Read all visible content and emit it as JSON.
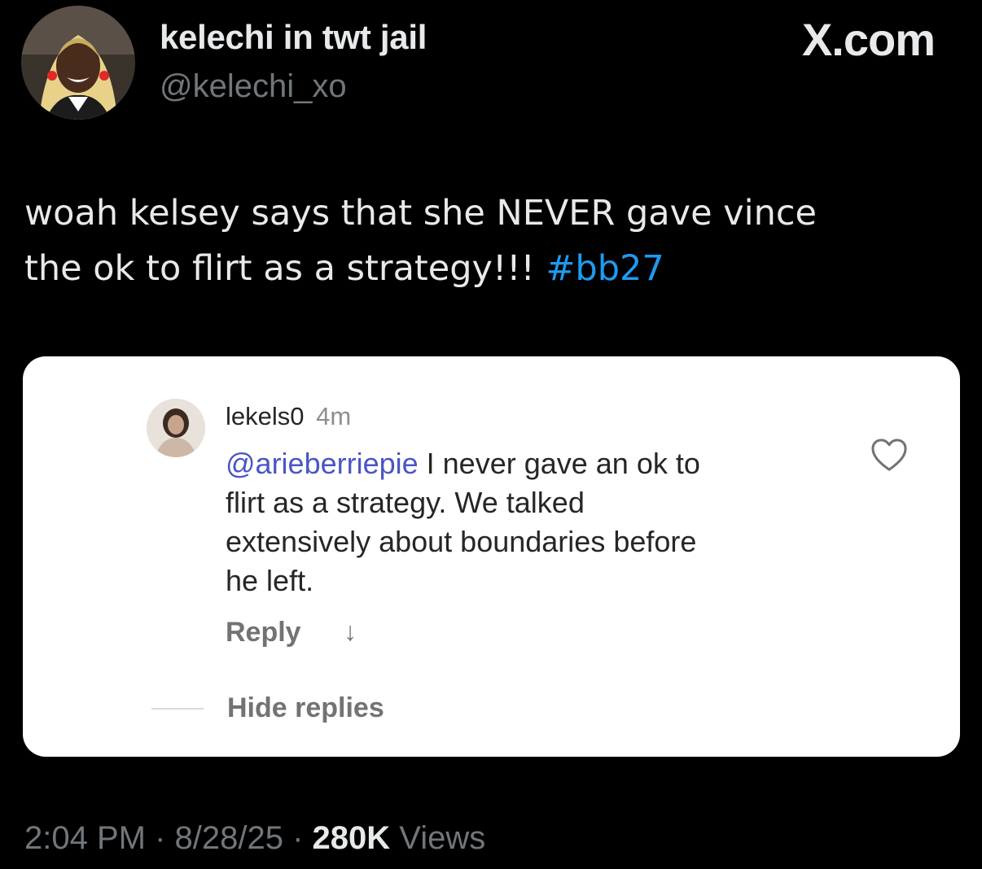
{
  "author": {
    "display_name": "kelechi in twt jail",
    "handle": "@kelechi_xo",
    "avatar_icon": "profile-photo"
  },
  "site_label": "X.com",
  "tweet": {
    "text_line1": "woah kelsey says that she NEVER gave vince",
    "text_line2_prefix": "the ok to flirt as a strategy!!! ",
    "hashtag": "#bb27"
  },
  "embedded_comment": {
    "username": "lekels0",
    "time": "4m",
    "mention": "@arieberriepie",
    "line1_rest": " I never gave an ok to",
    "line2": "flirt as a strategy. We talked",
    "line3": "extensively about boundaries before",
    "line4": "he left.",
    "reply_label": "Reply",
    "reply_arrow": "↓",
    "hide_replies_label": "Hide replies",
    "like_icon": "heart-outline-icon"
  },
  "footer": {
    "time": "2:04 PM",
    "sep1": " · ",
    "date": "8/28/25",
    "sep2": " · ",
    "views_count": "280K",
    "views_label": " Views"
  },
  "colors": {
    "background": "#000000",
    "text_primary": "#e7e9ea",
    "text_secondary": "#71767b",
    "hashtag": "#1d9bf0",
    "mention": "#4a55c5"
  }
}
